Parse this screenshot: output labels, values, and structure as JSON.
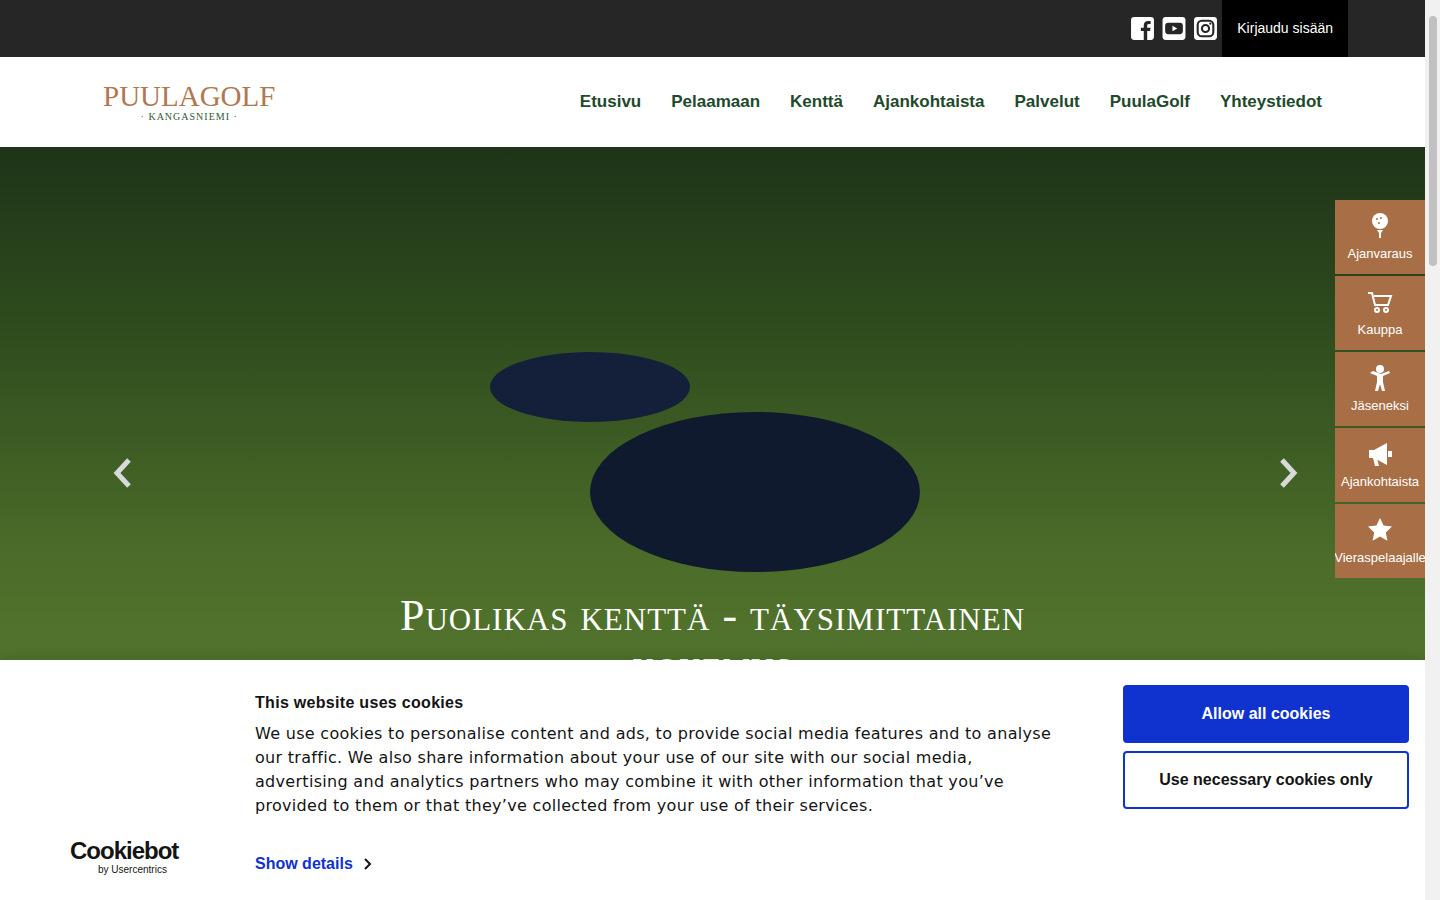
{
  "topbar": {
    "login": "Kirjaudu sisään"
  },
  "logo": {
    "name": "PUULAGOLF",
    "place": "· KANGASNIEMI ·"
  },
  "nav": [
    "Etusivu",
    "Pelaamaan",
    "Kenttä",
    "Ajankohtaista",
    "Palvelut",
    "PuulaGolf",
    "Yhteystiedot"
  ],
  "hero": {
    "title": "Puolikas kenttä - täysimittainen kokemus"
  },
  "quick_links": [
    "Ajanvaraus",
    "Kauppa",
    "Jäseneksi",
    "Ajankohtaista",
    "Vieraspelaajalle"
  ],
  "cookie_banner": {
    "title": "This website uses cookies",
    "body": "We use cookies to personalise content and ads, to provide social media features and to analyse our traffic. We also share information about your use of our site with our social media, advertising and analytics partners who may combine it with other information that you’ve provided to them or that they’ve collected from your use of their services.",
    "details": "Show details",
    "brand": "Cookiebot",
    "brand_sub": "by Usercentrics",
    "buttons": [
      "Allow all cookies",
      "Use necessary cookies only"
    ]
  }
}
